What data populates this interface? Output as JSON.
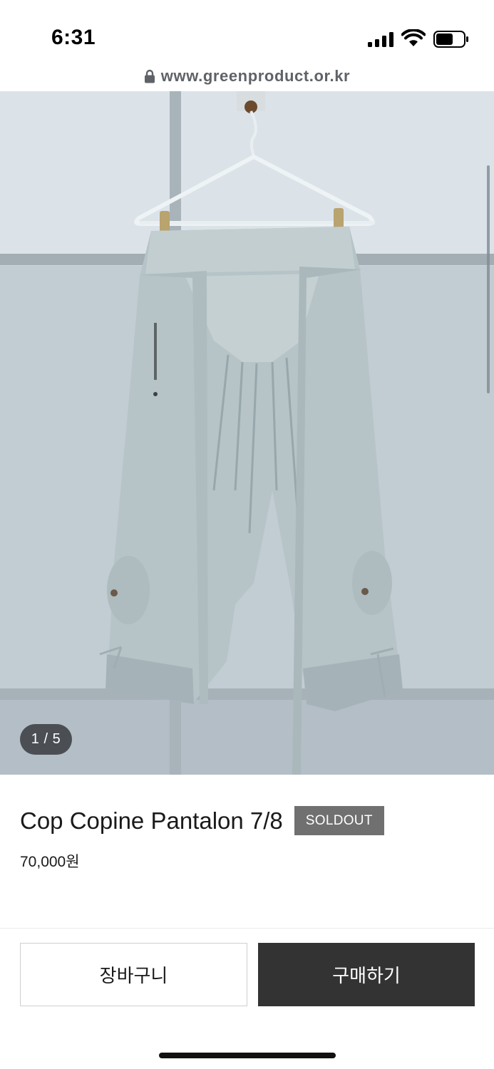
{
  "status_bar": {
    "time": "6:31"
  },
  "browser": {
    "url": "www.greenproduct.or.kr"
  },
  "gallery": {
    "counter": "1 / 5"
  },
  "product": {
    "title": "Cop Copine Pantalon 7/8",
    "badge": "SOLDOUT",
    "price": "70,000원"
  },
  "actions": {
    "cart_label": "장바구니",
    "buy_label": "구매하기"
  },
  "colors": {
    "buy_button": "#333333",
    "soldout_badge": "#707070",
    "garment": "#b6c3c7"
  }
}
